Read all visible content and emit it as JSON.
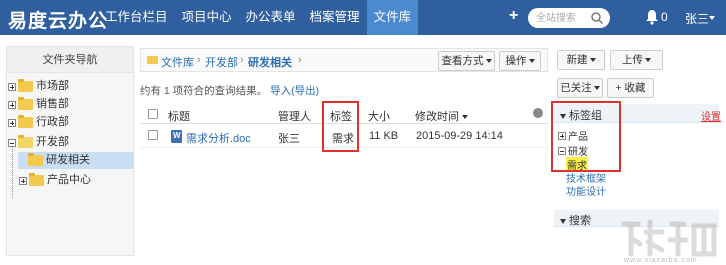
{
  "app": {
    "brand": "易度云办公"
  },
  "nav": {
    "items": [
      {
        "label": "工作台栏目",
        "active": false
      },
      {
        "label": "项目中心",
        "active": false
      },
      {
        "label": "办公表单",
        "active": false
      },
      {
        "label": "档案管理",
        "active": false
      },
      {
        "label": "文件库",
        "active": true
      }
    ]
  },
  "topbar": {
    "plus_label": "+",
    "search_placeholder": "全站搜索",
    "notification_count": "0",
    "user_name": "张三"
  },
  "sidebar": {
    "title": "文件夹导航",
    "items": [
      {
        "label": "市场部",
        "expanded": false,
        "selected": false
      },
      {
        "label": "销售部",
        "expanded": false,
        "selected": false
      },
      {
        "label": "行政部",
        "expanded": false,
        "selected": false
      },
      {
        "label": "开发部",
        "expanded": true,
        "selected": false
      },
      {
        "label": "研发相关",
        "expanded": false,
        "selected": true
      },
      {
        "label": "产品中心",
        "expanded": false,
        "selected": false
      }
    ]
  },
  "breadcrumb": {
    "items": [
      "文件库",
      "开发部",
      "研发相关"
    ]
  },
  "toolbar": {
    "view_label": "查看方式",
    "ops_label": "操作",
    "new_label": "新建",
    "upload_label": "上传",
    "followed_label": "已关注",
    "favorite_label": "+ 收藏"
  },
  "result": {
    "text": "约有 1 项符合的查询结果。",
    "import_label": "导入(导出)"
  },
  "table": {
    "columns": [
      "标题",
      "管理人",
      "标签",
      "大小",
      "修改时间"
    ],
    "rows": [
      {
        "title": "需求分析.doc",
        "manager": "张三",
        "tag": "需求",
        "size": "11 KB",
        "modified": "2015-09-29 14:14"
      }
    ]
  },
  "tag_panel": {
    "title": "标签组",
    "setting_label": "设置",
    "groups": [
      {
        "name": "产品",
        "expanded": false
      },
      {
        "name": "研发",
        "expanded": true,
        "tags": [
          "需求",
          "技术框架",
          "功能设计"
        ],
        "highlighted": "需求"
      }
    ]
  },
  "search_panel": {
    "title": "搜索"
  },
  "watermark": {
    "text": "www.xiazaiba.com"
  },
  "colors": {
    "topbar": "#2f5f9e",
    "active_tab": "#4a8bd0",
    "link": "#2a6db3",
    "highlight_box": "#e0322c",
    "tag_highlight": "#f8f14a"
  }
}
